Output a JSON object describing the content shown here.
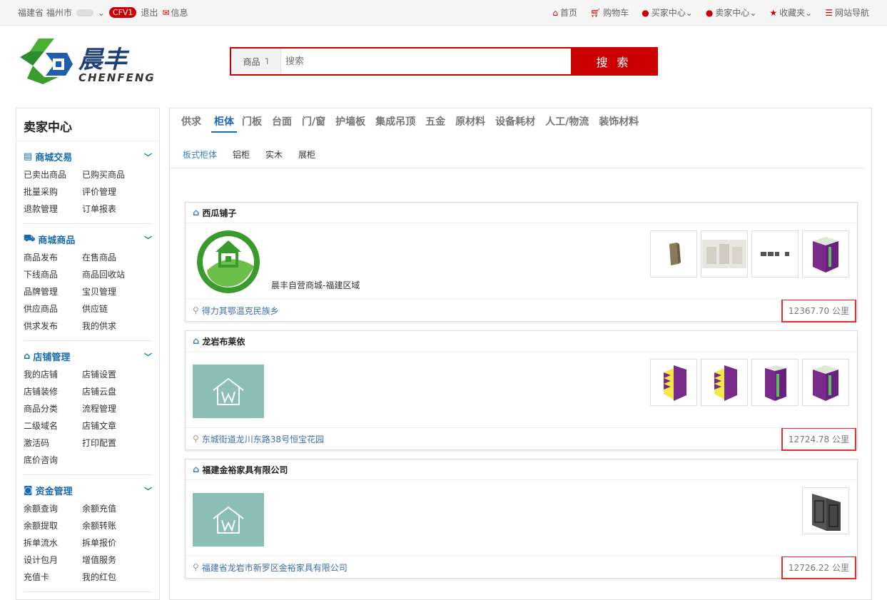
{
  "topbar": {
    "location": "福建省 福州市",
    "level_badge": "CFV1",
    "logout": "退出",
    "messages": "信息",
    "nav": [
      {
        "icon": "home-icon",
        "label": "首页"
      },
      {
        "icon": "cart-icon",
        "label": "购物车"
      },
      {
        "icon": "user-icon",
        "label": "买家中心"
      },
      {
        "icon": "user-icon",
        "label": "卖家中心"
      },
      {
        "icon": "star-icon",
        "label": "收藏夹"
      },
      {
        "icon": "list-icon",
        "label": "网站导航"
      }
    ]
  },
  "logo": {
    "cn": "晨丰",
    "en": "CHENFENG"
  },
  "search": {
    "category": "商品",
    "placeholder": "搜索",
    "button": "搜 索"
  },
  "sidebar": {
    "title": "卖家中心",
    "groups": [
      {
        "title": "商城交易",
        "icon": "card-icon",
        "items": [
          "已卖出商品",
          "已购买商品",
          "批量采购",
          "评价管理",
          "退款管理",
          "订单报表"
        ]
      },
      {
        "title": "商城商品",
        "icon": "truck-icon",
        "items": [
          "商品发布",
          "在售商品",
          "下线商品",
          "商品回收站",
          "品牌管理",
          "宝贝管理",
          "供应商品",
          "供应链",
          "供求发布",
          "我的供求"
        ]
      },
      {
        "title": "店铺管理",
        "icon": "home-icon",
        "items": [
          "我的店铺",
          "店铺设置",
          "店铺装修",
          "店铺云盘",
          "商品分类",
          "流程管理",
          "二级域名",
          "店铺文章",
          "激活码",
          "打印配置",
          "底价咨询"
        ]
      },
      {
        "title": "资金管理",
        "icon": "money-icon",
        "items": [
          "余额查询",
          "余额充值",
          "余额提取",
          "余额转账",
          "拆单流水",
          "拆单报价",
          "设计包月",
          "增值服务",
          "充值卡",
          "我的红包"
        ]
      }
    ]
  },
  "categories": [
    "供求",
    "柜体",
    "门板",
    "台面",
    "门/窗",
    "护墙板",
    "集成吊顶",
    "五金",
    "原材料",
    "设备耗材",
    "人工/物流",
    "装饰材料"
  ],
  "active_category": "柜体",
  "subcategories": [
    "板式柜体",
    "铝柜",
    "实木",
    "展柜"
  ],
  "active_subcategory": "板式柜体",
  "shops": [
    {
      "name": "西瓜铺子",
      "desc": "晨丰自营商城-福建区域",
      "address": "得力其鄂温克民族乡",
      "distance": "12367.70 公里",
      "thumbs": [
        "wood-cabinet",
        "showroom",
        "dashes",
        "purple-cabinet"
      ]
    },
    {
      "name": "龙岩布莱依",
      "desc": "",
      "address": "东城街道龙川东路38号恒宝花园",
      "distance": "12724.78 公里",
      "thumbs": [
        "yellow-purple-cabinet",
        "yellow-purple-cabinet",
        "green-purple-cabinet",
        "green-purple-cabinet"
      ]
    },
    {
      "name": "福建金裕家具有限公司",
      "desc": "",
      "address": "福建省龙岩市新罗区金裕家具有限公司",
      "distance": "12726.22 公里",
      "thumbs": [
        "grey-door"
      ]
    }
  ],
  "colors": {
    "accent": "#c00000",
    "link": "#1a6ab0",
    "highlight_box": "#e03030"
  }
}
